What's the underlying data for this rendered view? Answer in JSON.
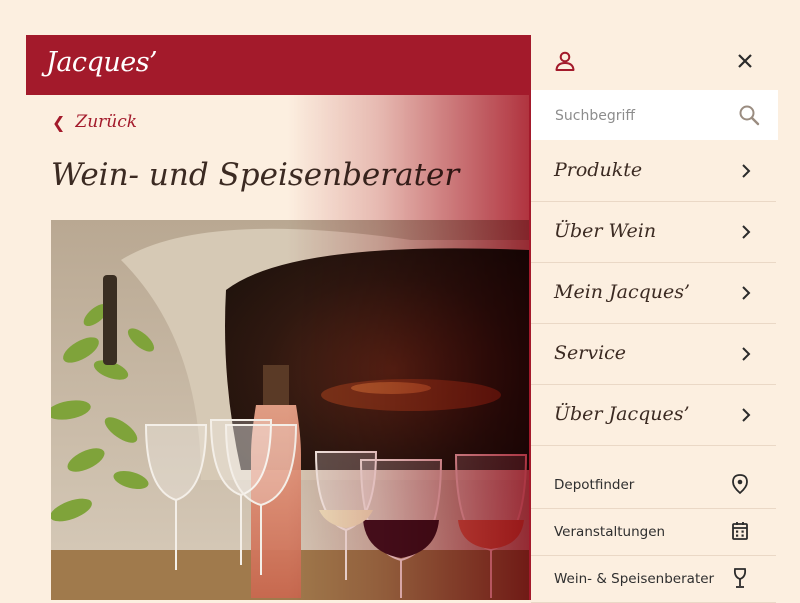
{
  "brand": {
    "logo_text": "Jacques’"
  },
  "page": {
    "back_label": "Zurück",
    "title": "Wein- und Speisenberater"
  },
  "photo": {
    "description_icon": "wine-glasses-photo"
  },
  "drawer": {
    "user_icon": "user-icon",
    "close_icon": "close-icon",
    "search": {
      "placeholder": "Suchbegriff",
      "value": ""
    },
    "nav": [
      {
        "label": "Produkte"
      },
      {
        "label": "Über Wein"
      },
      {
        "label": "Mein Jacques’"
      },
      {
        "label": "Service"
      },
      {
        "label": "Über Jacques’"
      }
    ],
    "utility": [
      {
        "label": "Depotfinder",
        "icon": "location-pin-icon"
      },
      {
        "label": "Veranstaltungen",
        "icon": "calendar-icon"
      },
      {
        "label": "Wein- & Speisenberater",
        "icon": "wine-glass-icon"
      }
    ]
  },
  "colors": {
    "brand_red": "#a31a2b",
    "background": "#fcefe0",
    "text": "#3b2a22"
  }
}
